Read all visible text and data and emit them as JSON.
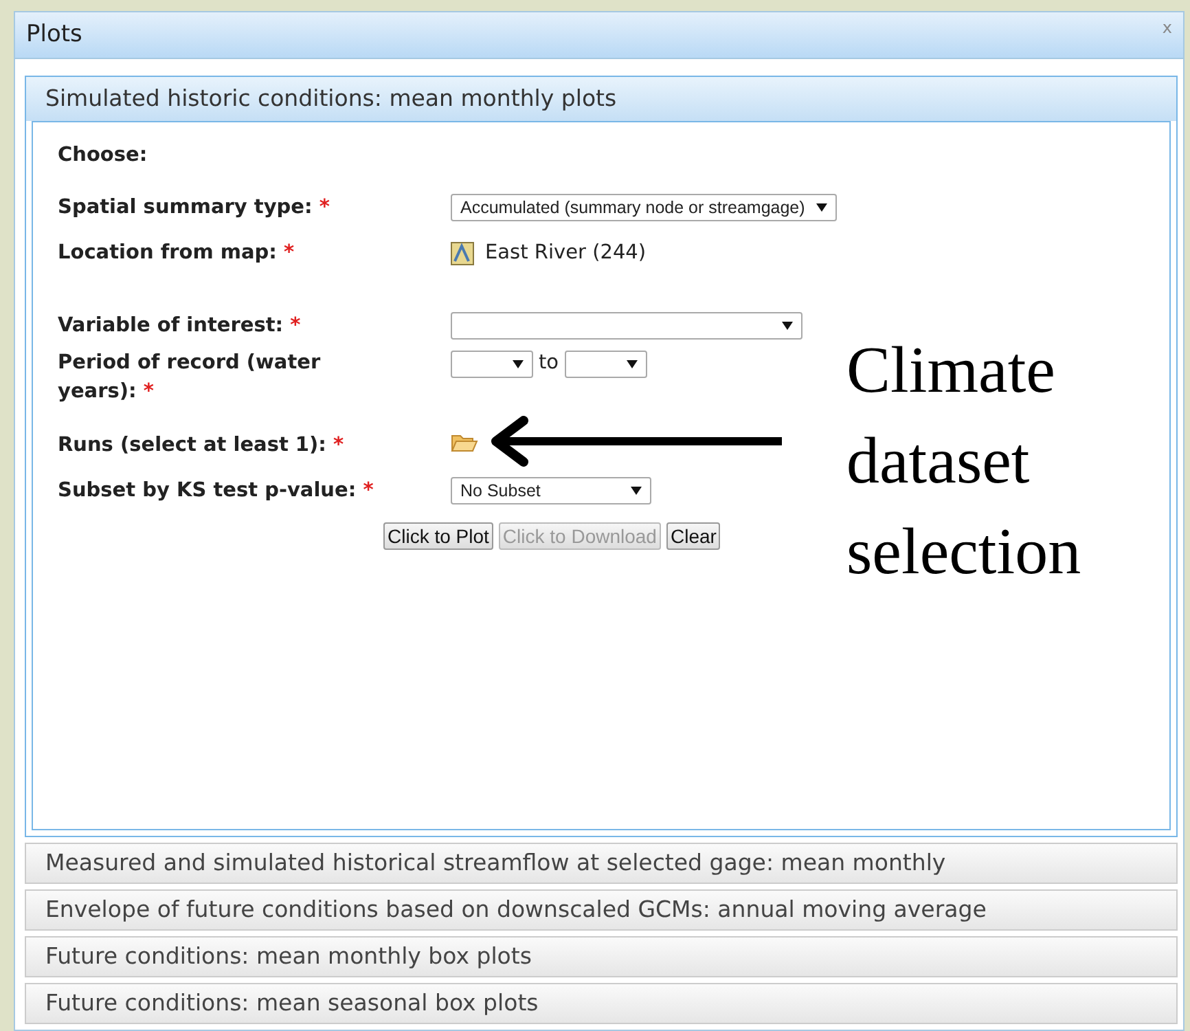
{
  "window": {
    "title": "Plots",
    "close": "x"
  },
  "section": {
    "title": "Simulated historic conditions: mean monthly plots",
    "heading": "Choose:",
    "fields": [
      {
        "kind": "select",
        "label": "Spatial summary type:",
        "required_mark": "*",
        "value": "Accumulated (summary node or streamgage)"
      },
      {
        "kind": "location",
        "label": "Location from map:",
        "required_mark": "*",
        "value": "East River (244)"
      },
      {
        "kind": "select",
        "label": "Variable of interest:",
        "required_mark": "*",
        "gap": true
      },
      {
        "kind": "range",
        "label": "Period of record (water years):",
        "required_mark": "*",
        "separator": "to"
      },
      {
        "kind": "folder",
        "label": "Runs (select at least 1):",
        "required_mark": "*"
      },
      {
        "kind": "select",
        "label": "Subset by KS test p-value:",
        "required_mark": "*",
        "value": "No Subset"
      }
    ],
    "buttons": [
      {
        "label": "Click to Plot",
        "disabled": false
      },
      {
        "label": "Click to Download",
        "disabled": true
      },
      {
        "label": "Clear",
        "disabled": false
      }
    ]
  },
  "other_sections": [
    {
      "title": "Measured and simulated historical streamflow at selected gage: mean monthly"
    },
    {
      "title": "Envelope of future conditions based on downscaled GCMs: annual moving average"
    },
    {
      "title": "Future conditions: mean monthly box plots"
    },
    {
      "title": "Future conditions: mean seasonal box plots"
    }
  ],
  "annotation": {
    "lines": [
      "Climate",
      "dataset",
      "selection"
    ]
  }
}
